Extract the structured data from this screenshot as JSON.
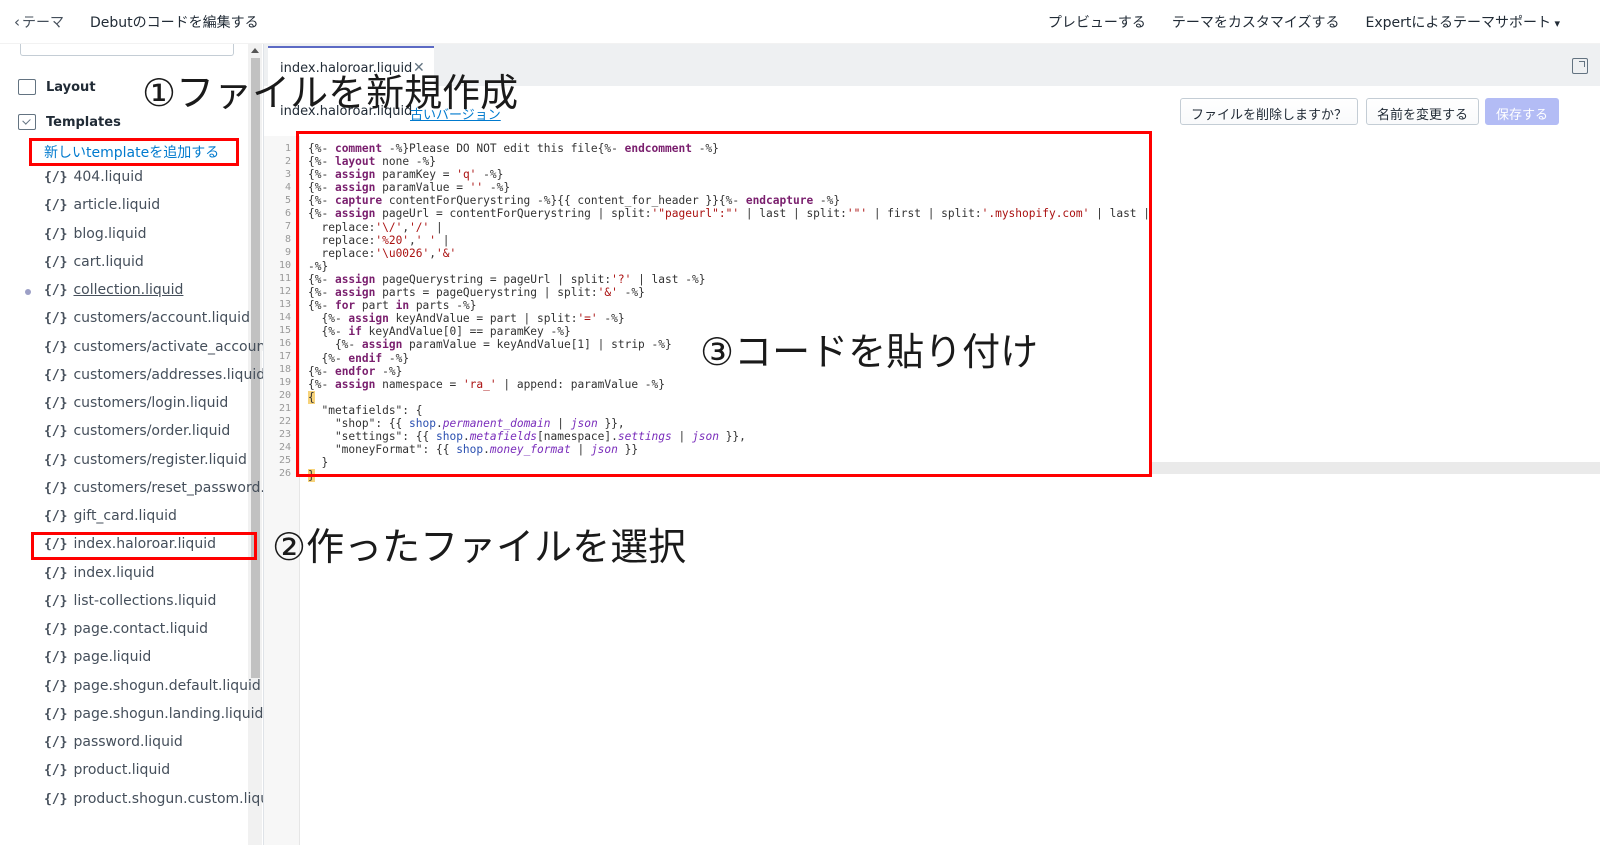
{
  "topbar": {
    "back_label": "テーマ",
    "title": "Debutのコードを編集する",
    "actions": [
      "プレビューする",
      "テーマをカスタマイズする"
    ],
    "support_label": "Expertによるテーマサポート"
  },
  "sidebar": {
    "folders": [
      {
        "label": "Layout"
      },
      {
        "label": "Templates"
      }
    ],
    "add_template_label": "新しいtemplateを追加する",
    "files": [
      "404.liquid",
      "article.liquid",
      "blog.liquid",
      "cart.liquid",
      "collection.liquid",
      "customers/account.liquid",
      "customers/activate_account.li",
      "customers/addresses.liquid",
      "customers/login.liquid",
      "customers/order.liquid",
      "customers/register.liquid",
      "customers/reset_password.liq",
      "gift_card.liquid",
      "index.haloroar.liquid",
      "index.liquid",
      "list-collections.liquid",
      "page.contact.liquid",
      "page.liquid",
      "page.shogun.default.liquid",
      "page.shogun.landing.liquid",
      "password.liquid",
      "product.liquid",
      "product.shogun.custom.liquic"
    ],
    "file_icon": "{/}"
  },
  "editor": {
    "tab_label": "index.haloroar.liquid",
    "file_name": "index.haloroar.liquid",
    "old_version_label": "古いバージョン",
    "delete_label": "ファイルを削除しますか？",
    "rename_label": "名前を変更する",
    "save_label": "保存する",
    "line_numbers": [
      "1",
      "2",
      "3",
      "4",
      "5",
      "6",
      "7",
      "8",
      "9",
      "10",
      "11",
      "12",
      "13",
      "14",
      "15",
      "16",
      "17",
      "18",
      "19",
      "20",
      "21",
      "22",
      "23",
      "24",
      "25",
      "26"
    ]
  },
  "annotations": {
    "step1": "①ファイルを新規作成",
    "step2": "②作ったファイルを選択",
    "step3": "③コードを貼り付け"
  },
  "colors": {
    "annotation_red": "#ff0000",
    "link_blue": "#007ace",
    "save_disabled": "#b3bcf5",
    "tab_accent": "#5c6ac4"
  }
}
